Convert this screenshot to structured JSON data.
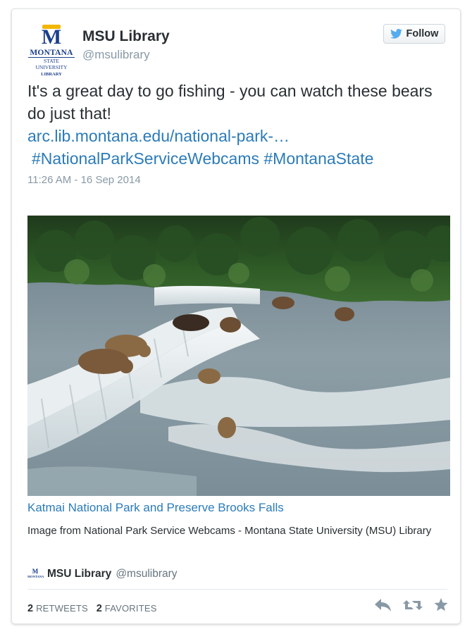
{
  "author": {
    "name": "MSU Library",
    "handle": "@msulibrary",
    "logo": {
      "letter": "M",
      "line1": "MONTANA",
      "line2": "STATE UNIVERSITY",
      "line3": "LIBRARY"
    }
  },
  "follow_button": {
    "label": "Follow",
    "icon": "twitter-bird-icon"
  },
  "tweet": {
    "text": "It's a great day to go fishing - you can watch these bears do just that!",
    "link": "arc.lib.montana.edu/national-park-…",
    "hashtags": "#NationalParkServiceWebcams #MontanaState",
    "timestamp": "11:26 AM - 16 Sep 2014"
  },
  "media_card": {
    "image_description_icon": "waterfall-bears-photo",
    "title": "Katmai National Park and Preserve Brooks Falls",
    "description": "Image from National Park Service Webcams - Montana State University (MSU) Library",
    "attribution_name": "MSU Library",
    "attribution_handle": "@msulibrary"
  },
  "stats": {
    "retweets_count": "2",
    "retweets_label": "RETWEETS",
    "favorites_count": "2",
    "favorites_label": "FAVORITES"
  },
  "actions": [
    "reply-icon",
    "retweet-icon",
    "favorite-star-icon"
  ],
  "colors": {
    "link": "#2b7bb9",
    "muted": "#8899a6",
    "text": "#292f33",
    "twitter_blue": "#55acee",
    "logo_blue": "#1b3f8b",
    "logo_gold": "#f2b705"
  }
}
